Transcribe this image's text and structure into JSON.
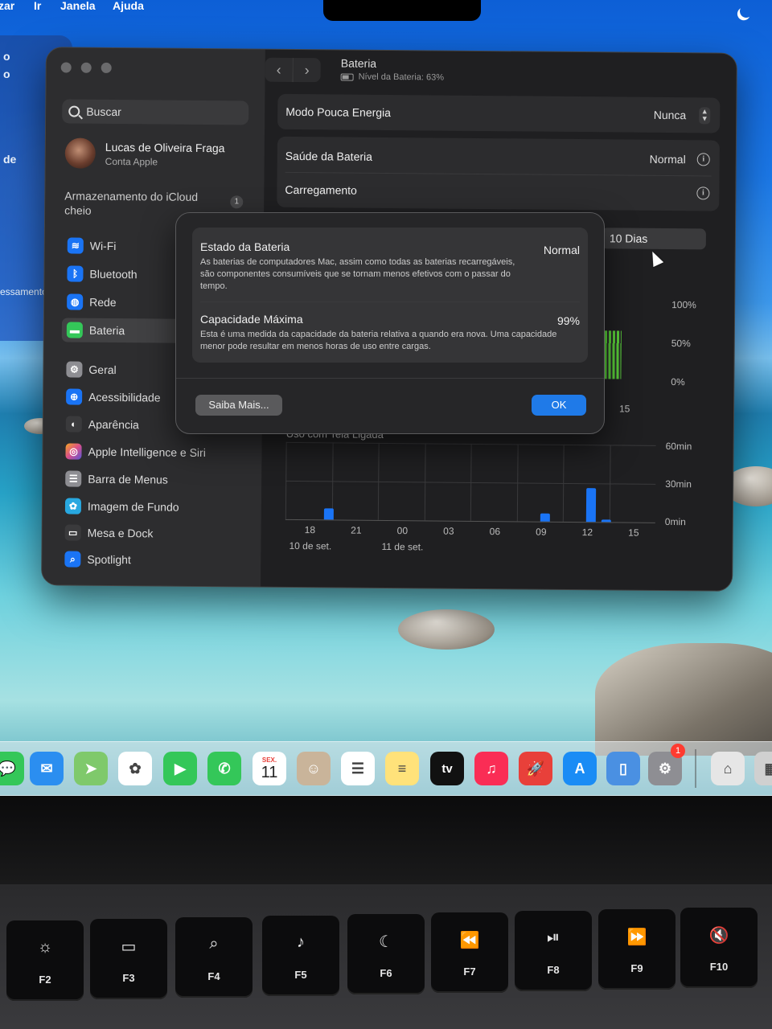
{
  "menubar": {
    "items": [
      "zar",
      "Ir",
      "Janela",
      "Ajuda"
    ]
  },
  "back_window": {
    "lines": [
      "o",
      "o",
      "de",
      "essamento"
    ]
  },
  "sidebar": {
    "search_placeholder": "Buscar",
    "user_name": "Lucas de Oliveira Fraga",
    "user_sub": "Conta Apple",
    "icloud_notice": "Armazenamento do iCloud cheio",
    "icloud_badge": "1",
    "items": [
      {
        "label": "Wi-Fi",
        "icon": "wifi-icon",
        "color": "#1a74f5"
      },
      {
        "label": "Bluetooth",
        "icon": "bluetooth-icon",
        "color": "#1a74f5"
      },
      {
        "label": "Rede",
        "icon": "globe-icon",
        "color": "#1a74f5"
      },
      {
        "label": "Bateria",
        "icon": "battery-icon",
        "color": "#34c759"
      },
      {
        "label": "Geral",
        "icon": "gear-icon",
        "color": "#8e8e93"
      },
      {
        "label": "Acessibilidade",
        "icon": "accessibility-icon",
        "color": "#1a74f5"
      },
      {
        "label": "Aparência",
        "icon": "appearance-icon",
        "color": "#3a3a3c"
      },
      {
        "label": "Apple Intelligence e Siri",
        "icon": "siri-icon",
        "color": "#d94f8c"
      },
      {
        "label": "Barra de Menus",
        "icon": "menubar-icon",
        "color": "#8e8e93"
      },
      {
        "label": "Imagem de Fundo",
        "icon": "wallpaper-icon",
        "color": "#28a8e0"
      },
      {
        "label": "Mesa e Dock",
        "icon": "dock-icon",
        "color": "#3a3a3c"
      },
      {
        "label": "Spotlight",
        "icon": "spotlight-icon",
        "color": "#1a74f5"
      }
    ]
  },
  "content": {
    "title": "Bateria",
    "subtitle": "Nível da Bateria: 63%",
    "low_power_label": "Modo Pouca Energia",
    "low_power_value": "Nunca",
    "health_label": "Saúde da Bateria",
    "health_value": "Normal",
    "charging_label": "Carregamento",
    "period_label": "10 Dias",
    "level_axis": [
      "100%",
      "50%",
      "0%"
    ],
    "level_tick": "15",
    "usage_title": "Uso com Tela Ligada",
    "usage_axis": [
      "60min",
      "30min",
      "0min"
    ],
    "usage_x_ticks": [
      "18",
      "21",
      "00",
      "03",
      "06",
      "09",
      "12",
      "15"
    ],
    "usage_dates": [
      "10 de set.",
      "11 de set."
    ]
  },
  "chart_data": {
    "type": "bar",
    "title": "Uso com Tela Ligada",
    "ylabel": "",
    "ylim": [
      0,
      60
    ],
    "x_ticks": [
      "18",
      "21",
      "00",
      "03",
      "06",
      "09",
      "12",
      "15"
    ],
    "series": [
      {
        "values": [
          {
            "x": "20",
            "y": 9
          },
          {
            "x": "10",
            "y": 6
          },
          {
            "x": "13",
            "y": 26
          },
          {
            "x": "14",
            "y": 2
          }
        ]
      }
    ],
    "colors": {
      "bar": "#1a74f5",
      "level": "#5ad13a"
    }
  },
  "modal": {
    "state_title": "Estado da Bateria",
    "state_value": "Normal",
    "state_desc": "As baterias de computadores Mac, assim como todas as baterias recarregáveis, são componentes consumíveis que se tornam menos efetivos com o passar do tempo.",
    "capacity_title": "Capacidade Máxima",
    "capacity_value": "99%",
    "capacity_desc": "Esta é uma medida da capacidade da bateria relativa a quando era nova. Uma capacidade menor pode resultar em menos horas de uso entre cargas.",
    "more_button": "Saiba Mais...",
    "ok_button": "OK"
  },
  "dock": {
    "calendar_month": "SEX.",
    "calendar_day": "11",
    "tv_label": "tv",
    "settings_badge": "1",
    "apps": [
      "messages-icon",
      "mail-icon",
      "maps-icon",
      "photos-icon",
      "facetime-icon",
      "phone-icon",
      "calendar-icon",
      "contacts-icon",
      "reminders-icon",
      "notes-icon",
      "appletv-icon",
      "music-icon",
      "rocket-icon",
      "appstore-icon",
      "iphone-mirroring-icon",
      "settings-icon",
      "preview-icon",
      "calculator-icon"
    ]
  },
  "keyboard": {
    "keys": [
      {
        "label": "F2",
        "icon": "brightness-icon",
        "sym": "☼"
      },
      {
        "label": "F3",
        "icon": "mission-control-icon",
        "sym": "▭"
      },
      {
        "label": "F4",
        "icon": "search-icon",
        "sym": "⌕"
      },
      {
        "label": "F5",
        "icon": "mic-icon",
        "sym": "♪"
      },
      {
        "label": "F6",
        "icon": "moon-icon",
        "sym": "☾"
      },
      {
        "label": "F7",
        "icon": "rewind-icon",
        "sym": "⏪"
      },
      {
        "label": "F8",
        "icon": "play-pause-icon",
        "sym": "⏯"
      },
      {
        "label": "F9",
        "icon": "fast-forward-icon",
        "sym": "⏩"
      },
      {
        "label": "F10",
        "icon": "mute-icon",
        "sym": "🔇"
      }
    ]
  }
}
